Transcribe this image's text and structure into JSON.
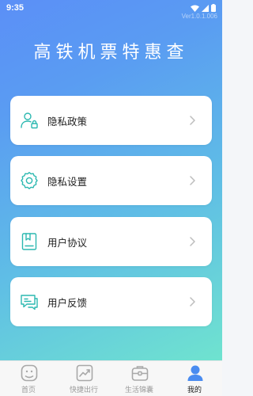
{
  "status_bar": {
    "time": "9:35",
    "version": "Ver1.0.1.006"
  },
  "page": {
    "title": "高铁机票特惠查"
  },
  "menu": [
    {
      "label": "隐私政策",
      "icon": "privacy-user-lock-icon"
    },
    {
      "label": "隐私设置",
      "icon": "gear-icon"
    },
    {
      "label": "用户协议",
      "icon": "document-bookmark-icon"
    },
    {
      "label": "用户反馈",
      "icon": "feedback-chat-icon"
    }
  ],
  "tabbar": [
    {
      "label": "首页",
      "icon": "home-icon",
      "active": false
    },
    {
      "label": "快捷出行",
      "icon": "trend-chart-icon",
      "active": false
    },
    {
      "label": "生活锦囊",
      "icon": "briefcase-icon",
      "active": false
    },
    {
      "label": "我的",
      "icon": "user-icon",
      "active": true
    }
  ],
  "colors": {
    "accent": "#2bb8b0",
    "gradient_start": "#5b8ff7",
    "gradient_end": "#6fe3cf",
    "tab_active_icon": "#4a8cf0"
  }
}
